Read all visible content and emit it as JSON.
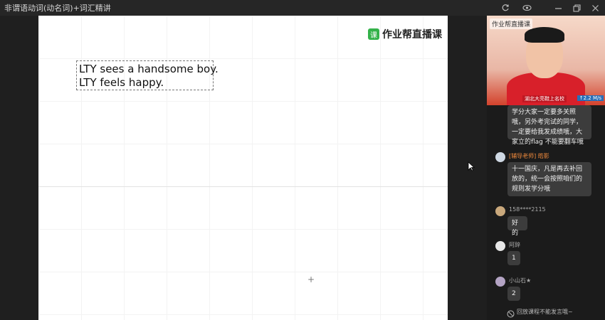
{
  "window": {
    "title": "非谓语动词(动名词)+词汇精讲"
  },
  "window_controls": [
    {
      "name": "refresh-icon",
      "glyph": "↻"
    },
    {
      "name": "eye-icon",
      "glyph": "◉"
    },
    {
      "name": "minimize-icon",
      "glyph": "—"
    },
    {
      "name": "restore-icon",
      "glyph": "❐"
    },
    {
      "name": "close-icon",
      "glyph": "✕"
    }
  ],
  "stage": {
    "logo_mark": "课",
    "logo_text": "作业帮直播课",
    "lines": [
      "LTY sees a handsome boy.",
      "LTY feels happy."
    ],
    "cursor_mark": "+"
  },
  "video": {
    "brand": "作业帮直播课",
    "caption": "湖北大亮鞋上名校",
    "net_speed": "↑2.2 M/s"
  },
  "chat": {
    "messages": [
      {
        "user": "",
        "text": "学分大家一定要多关照哦，另外考完试的同学，一定要给我发成绩哦，大家立的flag 不能要翻车哦"
      },
      {
        "user": "[辅导老师] 皓影",
        "text": "十一国庆，凡是再去补回放的，统一会按照咱们的规则发学分哦"
      },
      {
        "user": "158****2115",
        "text": "好的"
      },
      {
        "user": "阿辞",
        "text": "1"
      },
      {
        "user": "小山石★",
        "text": "2"
      }
    ],
    "footer_note": "回放课程不能发言哦~"
  },
  "colors": {
    "accent_green": "#34b24a",
    "teacher_name": "#f08a3c"
  }
}
